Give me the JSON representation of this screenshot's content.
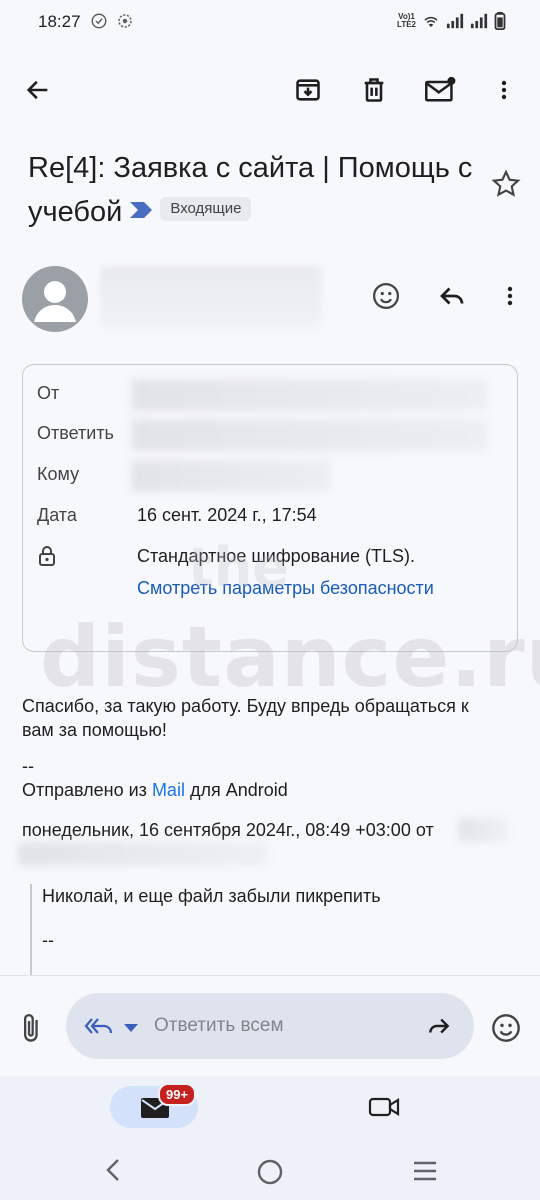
{
  "status_bar": {
    "time": "18:27",
    "volte_line1": "Vo)1",
    "volte_line2": "LTE2"
  },
  "toolbar": {
    "back": "arrow-back-icon",
    "archive": "archive-icon",
    "delete": "trash-icon",
    "mark_unread": "mark-unread-icon",
    "more": "more-vert-icon"
  },
  "email": {
    "subject": "Re[4]: Заявка с сайта | Помощь с учебой",
    "label": "Входящие"
  },
  "details": {
    "from_label": "От",
    "reply_to_label": "Ответить",
    "to_label": "Кому",
    "date_label": "Дата",
    "date_value": "16 сент. 2024 г., 17:54",
    "encryption_text": "Стандартное шифрование (TLS).",
    "security_link": "Смотреть параметры безопасности"
  },
  "watermark": {
    "line1": "the",
    "line2": "distance.ru"
  },
  "message": {
    "body_line1": "Спасибо, за такую работу. Буду впредь обращаться к",
    "body_line2": "вам за помощью!",
    "sig_dash": "--",
    "sent_from_prefix": "Отправлено из ",
    "sent_from_app": "Mail",
    "sent_from_suffix": " для Android",
    "quote_header": "понедельник, 16 сентября 2024г., 08:49 +03:00 от",
    "quoted_text": "Николай, и еще файл забыли пикрепить",
    "quoted_dash": "--"
  },
  "reply_bar": {
    "placeholder": "Ответить всем"
  },
  "bottom_nav": {
    "mail_badge": "99+"
  },
  "colors": {
    "accent": "#1a73e8",
    "badge": "#c5221f",
    "pill": "#dfe3ee"
  }
}
